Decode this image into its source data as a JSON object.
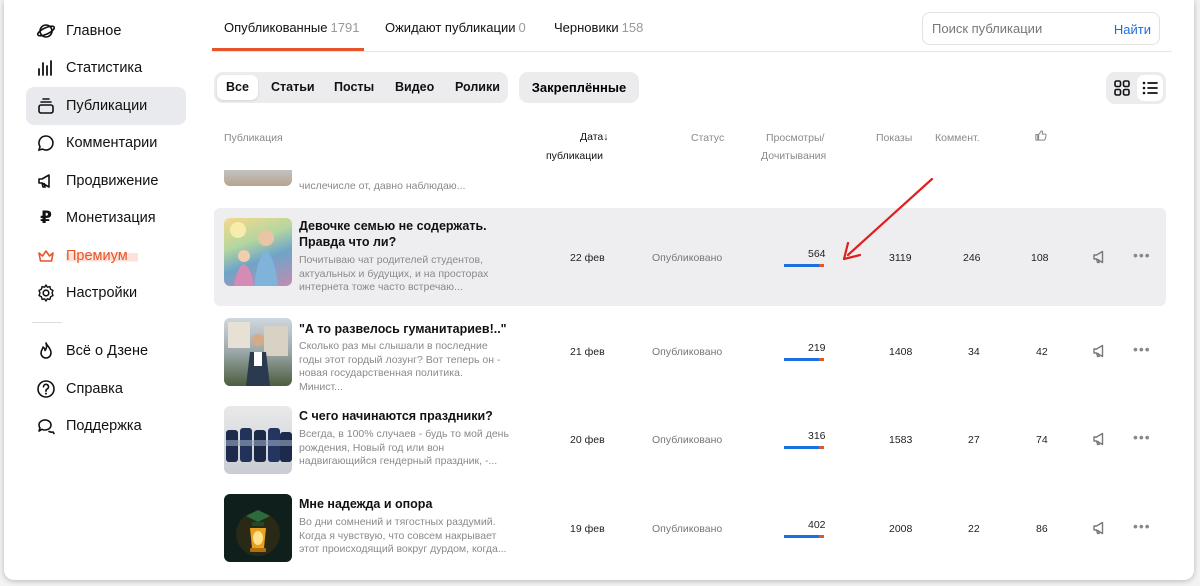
{
  "sidebar": {
    "items": [
      {
        "label": "Главное",
        "icon": "planet-icon"
      },
      {
        "label": "Статистика",
        "icon": "bar-chart-icon"
      },
      {
        "label": "Публикации",
        "icon": "stack-icon"
      },
      {
        "label": "Комментарии",
        "icon": "comment-icon"
      },
      {
        "label": "Продвижение",
        "icon": "megaphone-icon"
      },
      {
        "label": "Монетизация",
        "icon": "ruble-icon"
      },
      {
        "label": "Премиум",
        "icon": "crown-icon"
      },
      {
        "label": "Настройки",
        "icon": "gear-icon"
      }
    ],
    "bottom_items": [
      {
        "label": "Всё о Дзене",
        "icon": "flame-icon"
      },
      {
        "label": "Справка",
        "icon": "question-icon"
      },
      {
        "label": "Поддержка",
        "icon": "chat-icon"
      }
    ]
  },
  "tabs": [
    {
      "label": "Опубликованные",
      "count": "1791"
    },
    {
      "label": "Ожидают публикации",
      "count": "0"
    },
    {
      "label": "Черновики",
      "count": "158"
    }
  ],
  "search": {
    "placeholder": "Поиск публикации",
    "button": "Найти"
  },
  "filters": [
    "Все",
    "Статьи",
    "Посты",
    "Видео",
    "Ролики"
  ],
  "pinned_label": "Закреплённые",
  "columns": {
    "publication": "Публикация",
    "date_line1": "Дата",
    "date_line2": "публикации",
    "status": "Статус",
    "views_line1": "Просмотры/",
    "views_line2": "Дочитывания",
    "impressions": "Показы",
    "comments": "Коммент."
  },
  "partial_row": {
    "desc": "числечисле от, давно наблюдаю..."
  },
  "rows": [
    {
      "title": "Девочке семью не содержать. Правда что ли?",
      "desc": "Почитываю чат родителей студентов, актуальных и будущих, и на просторах интернета тоже часто встречаю...",
      "date": "22 фев",
      "status": "Опубликовано",
      "views": "564",
      "impressions": "3119",
      "comments": "246",
      "likes": "108"
    },
    {
      "title": "\"А то развелось гуманитариев!..\"",
      "desc": "Сколько раз мы слышали в последние годы этот гордый лозунг? Вот теперь он - новая государственная политика. Минист...",
      "date": "21 фев",
      "status": "Опубликовано",
      "views": "219",
      "impressions": "1408",
      "comments": "34",
      "likes": "42"
    },
    {
      "title": "С чего начинаются праздники?",
      "desc": "Всегда, в 100% случаев - будь то мой день рождения, Новый год или вон надвигающийся гендерный праздник, -...",
      "date": "20 фев",
      "status": "Опубликовано",
      "views": "316",
      "impressions": "1583",
      "comments": "27",
      "likes": "74"
    },
    {
      "title": "Мне надежда и опора",
      "desc": "Во дни сомнений и тягостных раздумий. Когда я чувствую, что совсем накрывает этот происходящий вокруг дурдом, когда...",
      "date": "19 фев",
      "status": "Опубликовано",
      "views": "402",
      "impressions": "2008",
      "comments": "22",
      "likes": "86"
    }
  ],
  "colors": {
    "accent": "#e8542a",
    "link": "#1a6ee0",
    "annotation_arrow": "#e02020"
  }
}
